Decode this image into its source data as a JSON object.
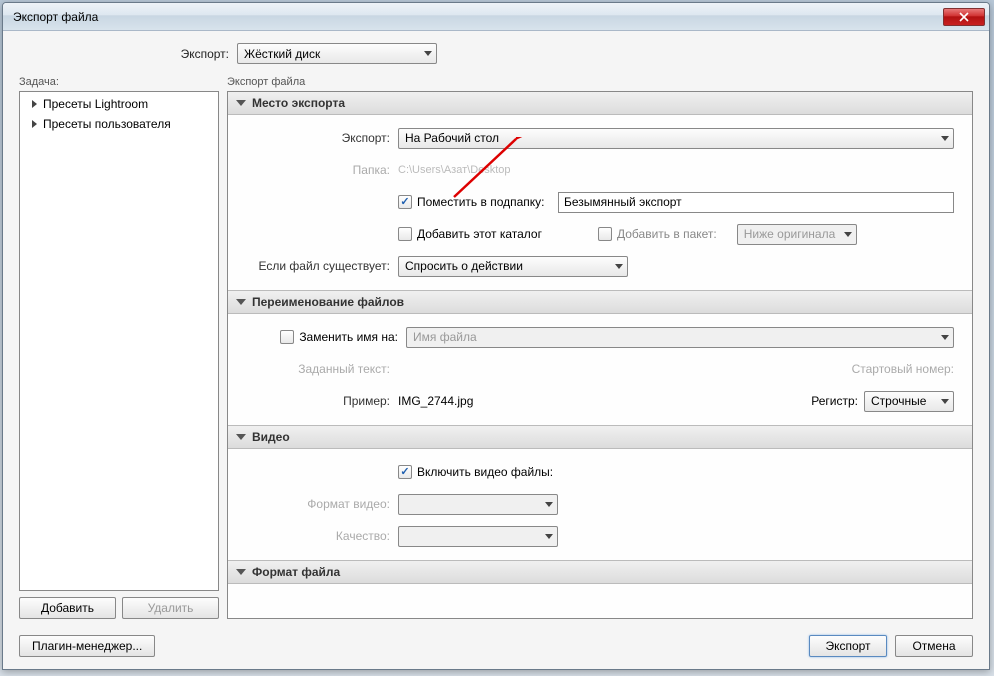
{
  "window": {
    "title": "Экспорт файла"
  },
  "top": {
    "label": "Экспорт:",
    "value": "Жёсткий диск"
  },
  "sidebar": {
    "label": "Задача:",
    "items": [
      {
        "label": "Пресеты Lightroom"
      },
      {
        "label": "Пресеты пользователя"
      }
    ],
    "add": "Добавить",
    "remove": "Удалить"
  },
  "main_label": "Экспорт файла",
  "sections": {
    "location": {
      "title": "Место экспорта",
      "export_label": "Экспорт:",
      "export_value": "На Рабочий стол",
      "folder_label": "Папка:",
      "folder_path": "C:\\Users\\Азат\\Desktop",
      "subfolder_check": "Поместить в подпапку:",
      "subfolder_value": "Безымянный экспорт",
      "addcatalog_check": "Добавить этот каталог",
      "addpacket_check": "Добавить в пакет:",
      "packet_value": "Ниже оригинала",
      "exists_label": "Если файл существует:",
      "exists_value": "Спросить о действии"
    },
    "rename": {
      "title": "Переименование файлов",
      "rename_check": "Заменить имя на:",
      "rename_value": "Имя файла",
      "text_label": "Заданный текст:",
      "start_label": "Стартовый номер:",
      "example_label": "Пример:",
      "example_value": "IMG_2744.jpg",
      "case_label": "Регистр:",
      "case_value": "Строчные"
    },
    "video": {
      "title": "Видео",
      "include_check": "Включить видео файлы:",
      "format_label": "Формат видео:",
      "quality_label": "Качество:"
    },
    "format": {
      "title": "Формат файла"
    }
  },
  "footer": {
    "plugin": "Плагин-менеджер...",
    "export": "Экспорт",
    "cancel": "Отмена"
  }
}
